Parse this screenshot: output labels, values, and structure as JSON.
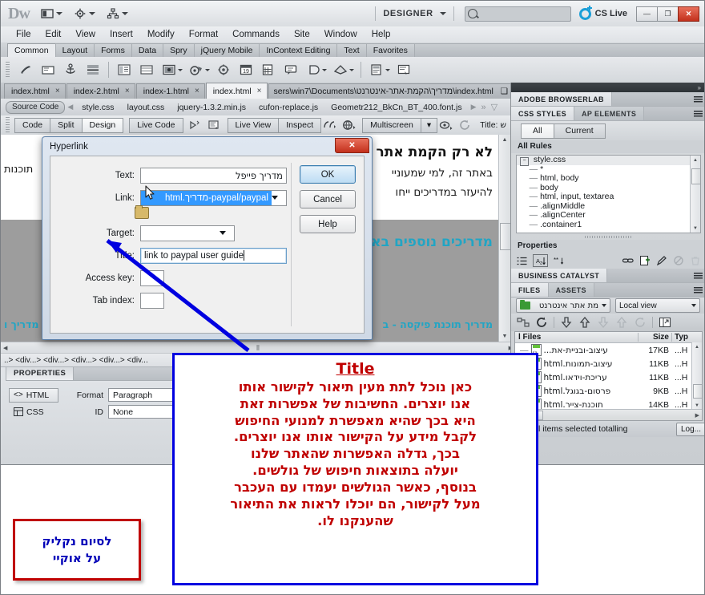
{
  "titlebar": {
    "logo": "Dw",
    "workspace": "DESIGNER",
    "search_placeholder": "",
    "cslive": "CS Live",
    "minimize": "—",
    "restore": "❐",
    "close": "✕"
  },
  "menubar": [
    "File",
    "Edit",
    "View",
    "Insert",
    "Modify",
    "Format",
    "Commands",
    "Site",
    "Window",
    "Help"
  ],
  "insertbar": {
    "tabs": [
      "Common",
      "Layout",
      "Forms",
      "Data",
      "Spry",
      "jQuery Mobile",
      "InContext Editing",
      "Text",
      "Favorites"
    ],
    "active": "Common"
  },
  "doctabs": {
    "tabs": [
      {
        "label": "index.html",
        "close": "×"
      },
      {
        "label": "index-2.html",
        "close": "×"
      },
      {
        "label": "index-1.html",
        "close": "×"
      },
      {
        "label": "index.html",
        "close": "×"
      }
    ],
    "path": "sers\\win7\\Documents\\מדריך\\הקמת-אתר-אינטרנט\\index.html"
  },
  "relatedfiles": {
    "source": "Source Code",
    "files": [
      "style.css",
      "layout.css",
      "jquery-1.3.2.min.js",
      "cufon-replace.js",
      "Geometr212_BkCn_BT_400.font.js"
    ]
  },
  "viewbar": {
    "code": "Code",
    "split": "Split",
    "design": "Design",
    "livecode": "Live Code",
    "liveview": "Live View",
    "inspect": "Inspect",
    "multiscreen": "Multiscreen",
    "title_label": "Title:",
    "title_value": "ש"
  },
  "canvas": {
    "heading1": "לא רק הקמת אתר א",
    "para1": "באתר זה, למי שמעוניי",
    "para2": "להיעזר במדריכים ייחו",
    "left_text": "תוכנות",
    "heading2": "מדריכים נוספים בא",
    "heading3": "מדריך תוכנת פיקסה - ב",
    "heading4": "מדריך ו"
  },
  "tagselector": "..> <div...> <div...> <div...> <div...> <div...",
  "properties": {
    "tab": "PROPERTIES",
    "html": "HTML",
    "css": "CSS",
    "format_label": "Format",
    "format_value": "Paragraph",
    "id_label": "ID",
    "id_value": "None"
  },
  "dialog": {
    "title": "Hyperlink",
    "close": "✕",
    "fields": {
      "text_label": "Text:",
      "text_value": "מדריך פייפל",
      "link_label": "Link:",
      "link_value": "paypal/paypal-מדריך.html",
      "target_label": "Target:",
      "target_value": "",
      "title_label": "Title:",
      "title_value": "link to paypal  user guide",
      "accesskey_label": "Access key:",
      "accesskey_value": "",
      "tabindex_label": "Tab index:",
      "tabindex_value": ""
    },
    "buttons": {
      "ok": "OK",
      "cancel": "Cancel",
      "help": "Help"
    }
  },
  "rightpanel": {
    "browserlab": "ADOBE BROWSERLAB",
    "cssstyles_tab": "CSS STYLES",
    "apelements_tab": "AP ELEMENTS",
    "seg_all": "All",
    "seg_current": "Current",
    "allrules_label": "All Rules",
    "rules": [
      "style.css",
      "*",
      "html, body",
      "body",
      "html, input, textarea",
      ".alignMiddle",
      ".alignCenter",
      ".container1"
    ],
    "properties_label": "Properties",
    "businesscatalyst": "BUSINESS CATALYST",
    "files_tab": "FILES",
    "assets_tab": "ASSETS",
    "site_select": "מת אתר אינטרנט",
    "view_select": "Local view",
    "columns": {
      "name": "l Files",
      "size": "Size",
      "type": "Typ"
    },
    "files": [
      {
        "name": "עיצוב-ובניית-את...",
        "size": "17KB",
        "type": "...H"
      },
      {
        "name": "עיצוב-תמונות.html",
        "size": "11KB",
        "type": "...H"
      },
      {
        "name": "עריכת-וידאו.html",
        "size": "11KB",
        "type": "...H"
      },
      {
        "name": "פרסום-בגוגל.html",
        "size": "9KB",
        "type": "...H"
      },
      {
        "name": "תוכנת-צייר.html",
        "size": "14KB",
        "type": "...H"
      }
    ],
    "status": "1 local items selected totalling",
    "log_button": "Log..."
  },
  "annotations": {
    "main": {
      "title": "Title",
      "lines": [
        "כאן נוכל לתת מעין תיאור לקישור אותו",
        "אנו יוצרים. החשיבות של אפשרות זאת",
        "היא בכך שהיא מאפשרת למנועי החיפוש",
        "לקבל מידע על הקישור אותו אנו יוצרים.",
        "בכך, גדלה האפשרות שהאתר שלנו",
        "יועלה בתוצאות חיפוש של גולשים.",
        "בנוסף, כאשר הגולשים יעמדו עם העכבר",
        "מעל לקישור, הם יוכלו לראות את התיאור",
        "שהענקנו לו."
      ]
    },
    "redbox": {
      "line1": "לסיום נקליק",
      "line2": "על אוקיי"
    }
  },
  "colors": {
    "annotation_red": "#c00000",
    "annotation_blue": "#0000e0",
    "accent_cyan": "#22a5c4",
    "selection_blue": "#3399ff"
  }
}
